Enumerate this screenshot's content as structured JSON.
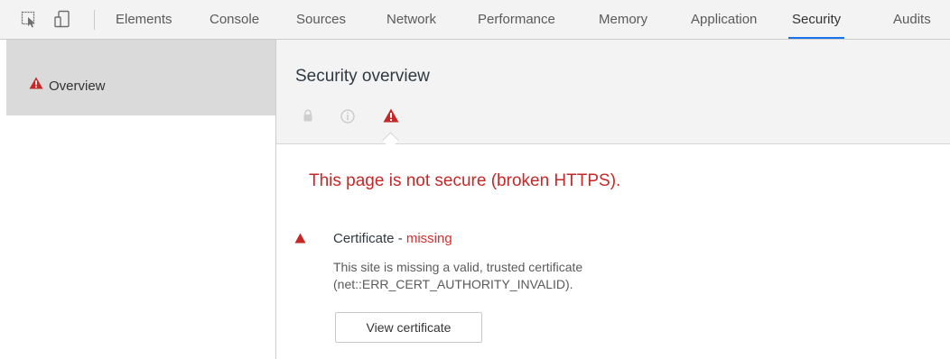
{
  "toolbar": {
    "tabs": [
      {
        "label": "Elements"
      },
      {
        "label": "Console"
      },
      {
        "label": "Sources"
      },
      {
        "label": "Network"
      },
      {
        "label": "Performance"
      },
      {
        "label": "Memory"
      },
      {
        "label": "Application"
      },
      {
        "label": "Security",
        "selected": true
      },
      {
        "label": "Audits"
      }
    ],
    "icons": [
      "inspect-element-icon",
      "device-toolbar-icon"
    ],
    "selected_tab_accent": "#1a73e8"
  },
  "sidebar": {
    "items": [
      {
        "label": "Overview",
        "icon": "warning-icon",
        "selected": true
      }
    ]
  },
  "main": {
    "title": "Security overview",
    "summary_icons": [
      "lock-icon",
      "info-icon",
      "warning-icon"
    ],
    "summary": "This page is not secure (broken HTTPS).",
    "explanation": {
      "title": "Certificate - ",
      "status": "missing",
      "desc_line1": "This site is missing a valid, trusted certificate",
      "desc_line2": "(net::ERR_CERT_AUTHORITY_INVALID).",
      "button": "View certificate"
    }
  },
  "colors": {
    "insecure": "#c62828",
    "toolbar_bg": "#f3f3f3",
    "sidebar_selected_bg": "#dadada"
  }
}
